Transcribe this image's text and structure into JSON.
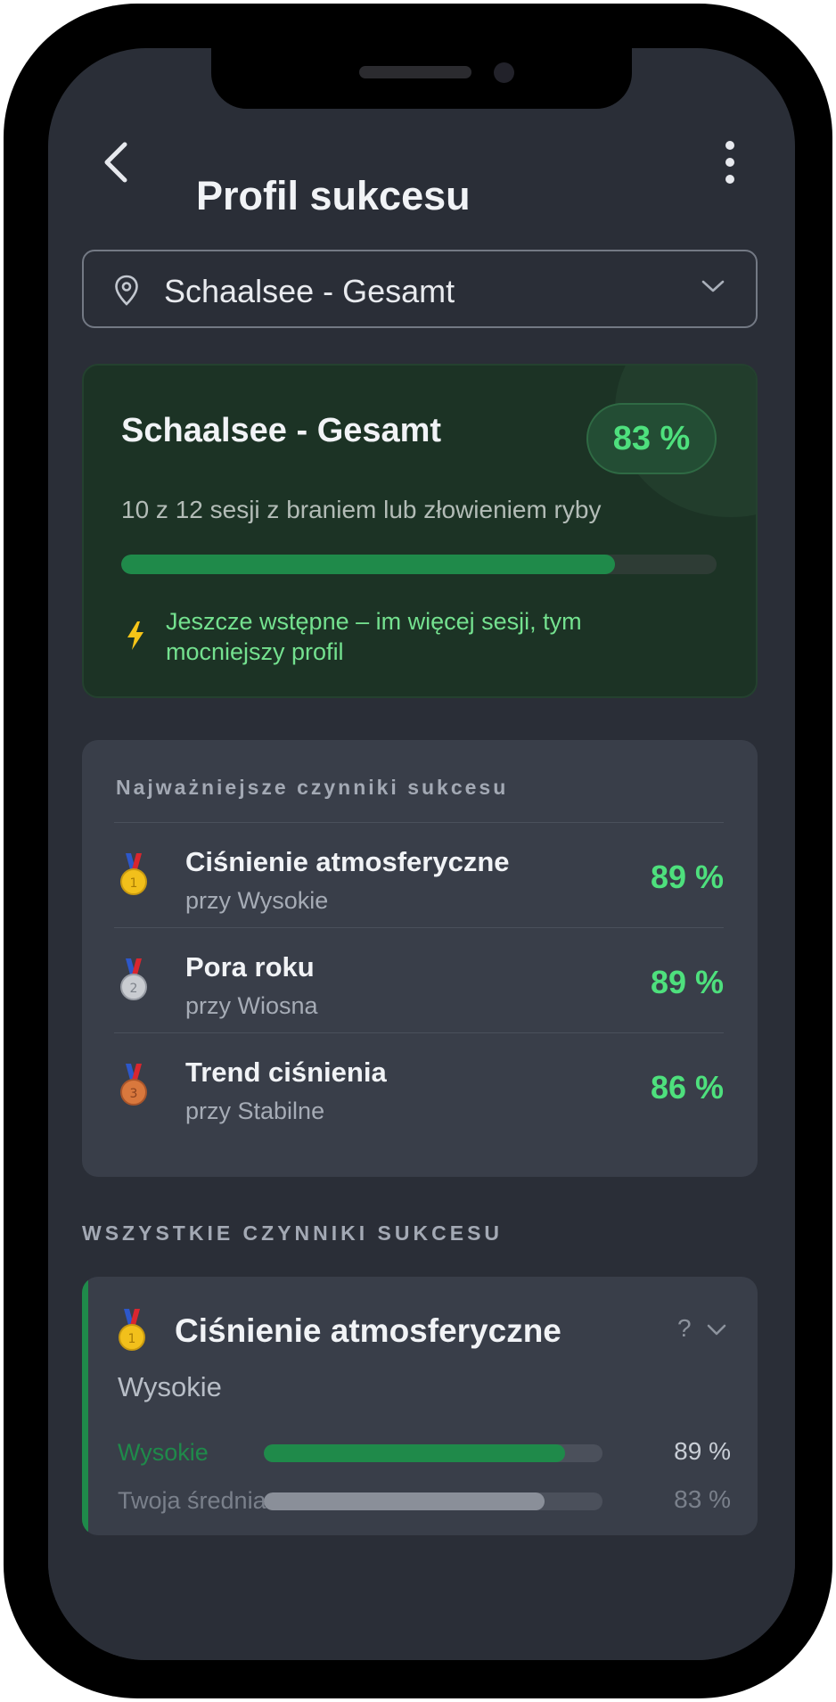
{
  "header": {
    "title": "Profil sukcesu"
  },
  "location_select": {
    "value": "Schaalsee - Gesamt"
  },
  "summary": {
    "title": "Schaalsee - Gesamt",
    "percent_label": "83 %",
    "percent": 0.83,
    "sessions_text": "10 z 12 sesji z braniem lub złowieniem ryby",
    "hint": "Jeszcze wstępne – im więcej sesji, tym mocniejszy profil",
    "bar_fill_color": "#1f8a4a"
  },
  "top_factors": {
    "section_label": "Najważniejsze czynniki sukcesu",
    "items": [
      {
        "rank": 1,
        "medal": "gold-medal",
        "name": "Ciśnienie atmosferyczne",
        "condition": "przy Wysokie",
        "percent_label": "89 %"
      },
      {
        "rank": 2,
        "medal": "silver-medal",
        "name": "Pora roku",
        "condition": "przy Wiosna",
        "percent_label": "89 %"
      },
      {
        "rank": 3,
        "medal": "bronze-medal",
        "name": "Trend ciśnienia",
        "condition": "przy Stabilne",
        "percent_label": "86 %"
      }
    ]
  },
  "all_factors": {
    "section_label": "WSZYSTKIE CZYNNIKI SUKCESU",
    "detail": {
      "medal": "gold-medal",
      "title": "Ciśnienie atmosferyczne",
      "help": "?",
      "subtitle": "Wysokie",
      "rows": [
        {
          "label": "Wysokie",
          "percent_label": "89 %",
          "percent": 0.89,
          "color": "#1f8a4a",
          "label_color": "#1f8a4a",
          "pct_color": "#c9ced6"
        },
        {
          "label": "Twoja średnia",
          "percent_label": "83 %",
          "percent": 0.83,
          "color": "#8a8f99",
          "label_color": "#7a808b",
          "pct_color": "#7a808b"
        }
      ]
    }
  },
  "colors": {
    "accent_green": "#4ee07d",
    "bar_green": "#1f8a4a",
    "background": "#2a2e37",
    "card": "#393e49"
  }
}
